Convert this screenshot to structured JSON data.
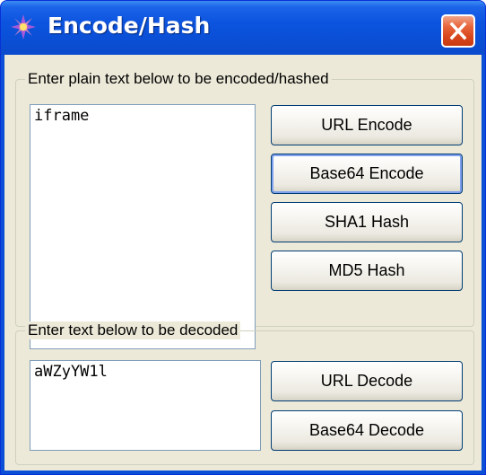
{
  "window": {
    "title": "Encode/Hash",
    "icon": "sparkle-app-icon",
    "close_icon": "close-x-icon",
    "accent": "#0a4fd6",
    "close_color": "#d8451b"
  },
  "encode_group": {
    "legend": "Enter plain text below to be encoded/hashed",
    "input_value": "iframe",
    "buttons": {
      "url_encode": "URL Encode",
      "base64_encode": "Base64 Encode",
      "sha1_hash": "SHA1 Hash",
      "md5_hash": "MD5 Hash"
    }
  },
  "decode_group": {
    "legend": "Enter text below to be decoded",
    "input_value": "aWZyYW1l",
    "buttons": {
      "url_decode": "URL Decode",
      "base64_decode": "Base64 Decode"
    }
  }
}
